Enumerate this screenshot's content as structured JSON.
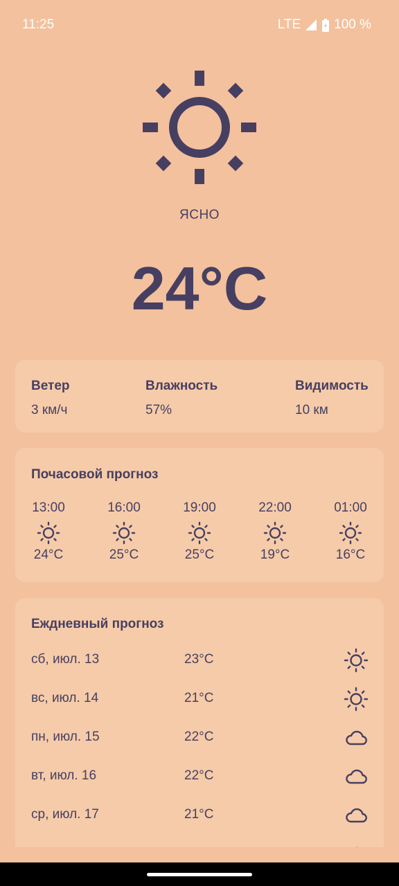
{
  "status_bar": {
    "time": "11:25",
    "network": "LTE",
    "battery": "100 %"
  },
  "current": {
    "icon": "sun-icon",
    "condition": "ЯСНО",
    "temperature": "24°C"
  },
  "stats": {
    "wind_label": "Ветер",
    "wind_value": "3 км/ч",
    "humidity_label": "Влажность",
    "humidity_value": "57%",
    "visibility_label": "Видимость",
    "visibility_value": "10 км"
  },
  "hourly": {
    "title": "Почасовой прогноз",
    "items": [
      {
        "time": "13:00",
        "icon": "sun-icon",
        "temp": "24°C"
      },
      {
        "time": "16:00",
        "icon": "sun-icon",
        "temp": "25°C"
      },
      {
        "time": "19:00",
        "icon": "sun-icon",
        "temp": "25°C"
      },
      {
        "time": "22:00",
        "icon": "sun-icon",
        "temp": "19°C"
      },
      {
        "time": "01:00",
        "icon": "sun-icon",
        "temp": "16°C"
      }
    ]
  },
  "daily": {
    "title": "Еждневный прогноз",
    "items": [
      {
        "date": "сб, июл. 13",
        "temp": "23°C",
        "icon": "sun-icon"
      },
      {
        "date": "вс, июл. 14",
        "temp": "21°C",
        "icon": "sun-icon"
      },
      {
        "date": "пн, июл. 15",
        "temp": "22°C",
        "icon": "cloud-icon"
      },
      {
        "date": "вт, июл. 16",
        "temp": "22°C",
        "icon": "cloud-icon"
      },
      {
        "date": "ср, июл. 17",
        "temp": "21°C",
        "icon": "cloud-icon"
      }
    ]
  },
  "colors": {
    "background": "#f3c19d",
    "card": "#f5cba9",
    "text": "#473f61"
  }
}
